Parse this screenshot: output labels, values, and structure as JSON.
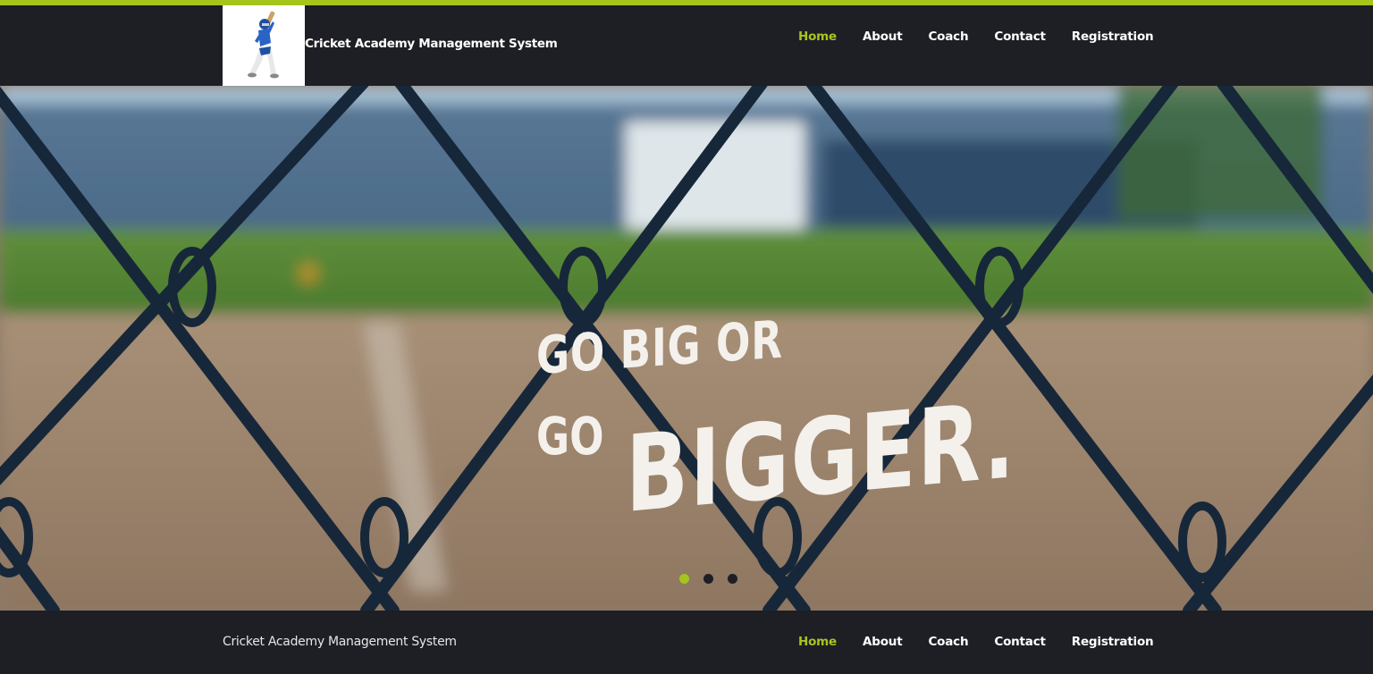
{
  "header": {
    "brand_title": "Cricket Academy Management System",
    "logo_icon": "cricket-batsman-icon"
  },
  "nav": {
    "items": [
      {
        "label": "Home",
        "active": true
      },
      {
        "label": "About",
        "active": false
      },
      {
        "label": "Coach",
        "active": false
      },
      {
        "label": "Contact",
        "active": false
      },
      {
        "label": "Registration",
        "active": false
      }
    ]
  },
  "hero": {
    "line1": "GO BIG OR",
    "line2_prefix": "GO",
    "line2_emphasis": "BIGGER.",
    "slides": {
      "count": 3,
      "active_index": 0
    }
  },
  "footer": {
    "brand_title": "Cricket Academy Management System",
    "items": [
      {
        "label": "Home",
        "active": true
      },
      {
        "label": "About",
        "active": false
      },
      {
        "label": "Coach",
        "active": false
      },
      {
        "label": "Contact",
        "active": false
      },
      {
        "label": "Registration",
        "active": false
      }
    ]
  },
  "colors": {
    "accent": "#a6c51c",
    "header_bg": "#1e1e25",
    "text": "#ffffff"
  }
}
